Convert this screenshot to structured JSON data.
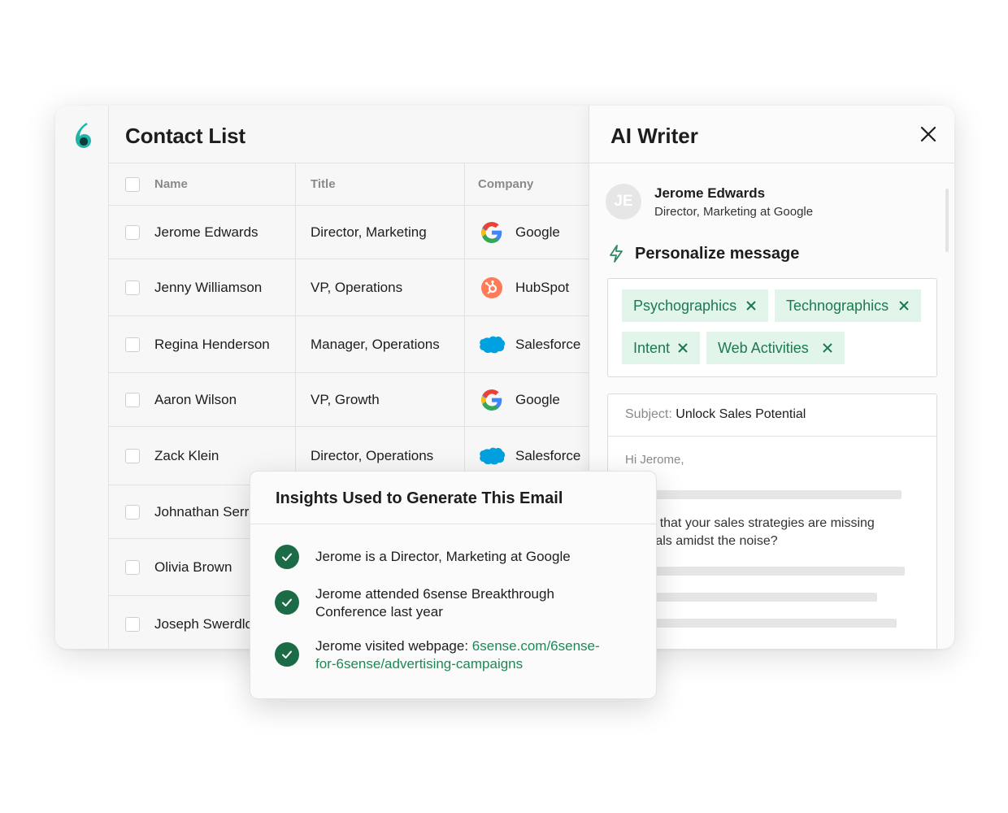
{
  "contacts": {
    "title": "Contact List",
    "headers": {
      "name": "Name",
      "title": "Title",
      "company": "Company"
    },
    "rows": [
      {
        "name": "Jerome Edwards",
        "title": "Director, Marketing",
        "company": "Google",
        "logo": "google-logo"
      },
      {
        "name": "Jenny Williamson",
        "title": "VP, Operations",
        "company": "HubSpot",
        "logo": "hubspot-logo"
      },
      {
        "name": "Regina Henderson",
        "title": "Manager, Operations",
        "company": "Salesforce",
        "logo": "salesforce-logo"
      },
      {
        "name": "Aaron Wilson",
        "title": "VP, Growth",
        "company": "Google",
        "logo": "google-logo"
      },
      {
        "name": "Zack Klein",
        "title": "Director, Operations",
        "company": "Salesforce",
        "logo": "salesforce-logo"
      },
      {
        "name": "Johnathan Serr",
        "title": "",
        "company": ""
      },
      {
        "name": "Olivia Brown",
        "title": "",
        "company": ""
      },
      {
        "name": "Joseph Swerdlo",
        "title": "",
        "company": ""
      }
    ]
  },
  "writer": {
    "title": "AI Writer",
    "close_icon": "close-icon",
    "contact": {
      "initials": "JE",
      "name": "Jerome Edwards",
      "role": "Director, Marketing at Google"
    },
    "personalize_label": "Personalize message",
    "personalize_icon": "lightning-icon",
    "tags": [
      "Psychographics",
      "Technographics",
      "Intent",
      "Web Activities"
    ],
    "email": {
      "subject_label": "Subject:",
      "subject": "Unlock Sales Potential",
      "greeting": "Hi Jerome,",
      "line1": "l it be that your sales strategies are missing",
      "line2": "l signals amidst the noise?"
    }
  },
  "insights": {
    "title": "Insights Used to Generate This Email",
    "items": [
      {
        "text": "Jerome is a Director, Marketing at Google"
      },
      {
        "line1": "Jerome attended 6sense Breakthrough",
        "line2": "Conference last year"
      },
      {
        "text": "Jerome visited webpage: ",
        "link_line1": "6sense.com/6sense-",
        "link_line2": "for-6sense/advertising-campaigns"
      }
    ]
  },
  "colors": {
    "accent_green": "#1b6b47",
    "tag_bg": "#e2f5ea",
    "tag_text": "#1b7a4e",
    "link": "#1b8a55",
    "brand_teal": "#1fb5a8"
  }
}
